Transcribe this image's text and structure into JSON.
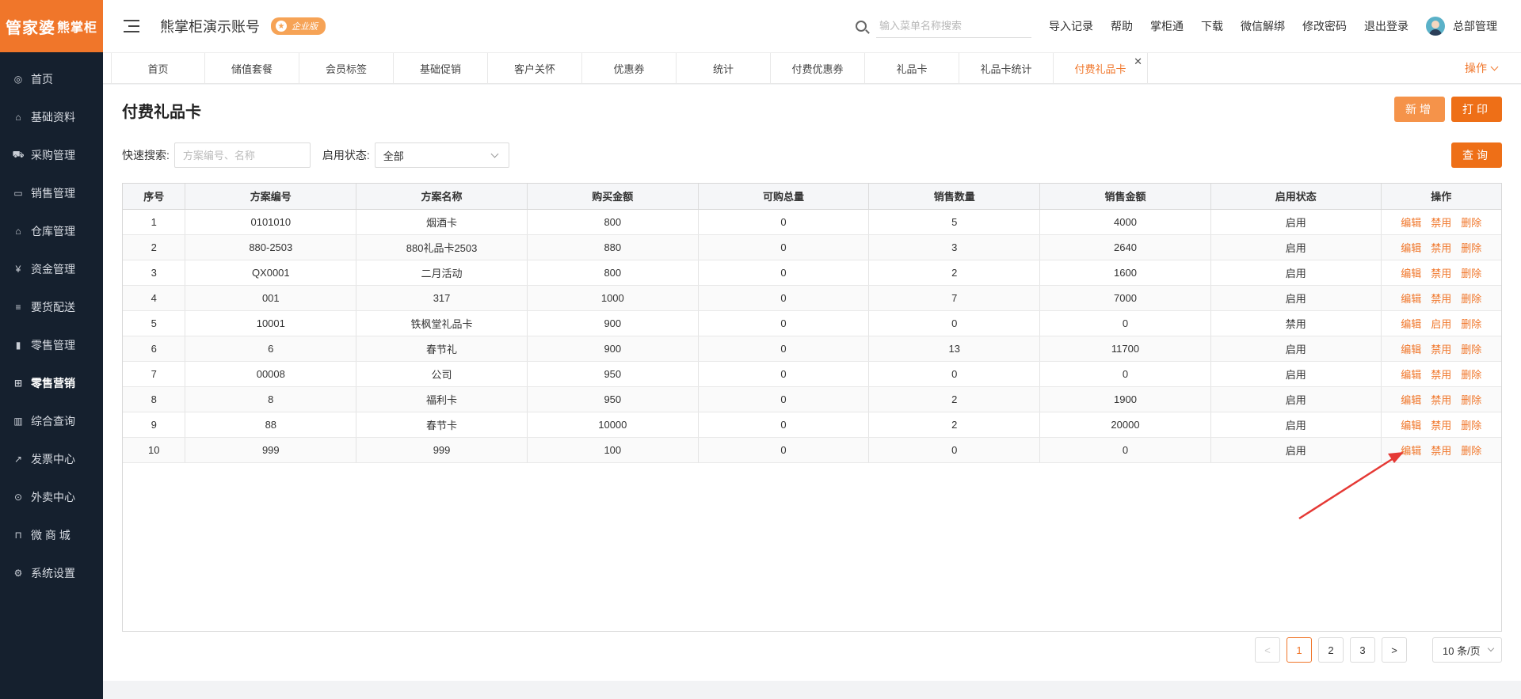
{
  "logo": {
    "text": "管家婆",
    "sub": "熊掌柜"
  },
  "sidebar": {
    "items": [
      {
        "label": "首页",
        "icon": "globe-icon"
      },
      {
        "label": "基础资料",
        "icon": "home-icon"
      },
      {
        "label": "采购管理",
        "icon": "cart-icon"
      },
      {
        "label": "销售管理",
        "icon": "card-icon"
      },
      {
        "label": "仓库管理",
        "icon": "bank-icon"
      },
      {
        "label": "资金管理",
        "icon": "money-icon"
      },
      {
        "label": "要货配送",
        "icon": "list-icon"
      },
      {
        "label": "零售管理",
        "icon": "bar-chart-icon"
      },
      {
        "label": "零售营销",
        "icon": "gift-icon",
        "active": true
      },
      {
        "label": "综合查询",
        "icon": "chart-icon"
      },
      {
        "label": "发票中心",
        "icon": "trend-icon"
      },
      {
        "label": "外卖中心",
        "icon": "delivery-icon"
      },
      {
        "label": "微 商 城",
        "icon": "shop-icon"
      },
      {
        "label": "系统设置",
        "icon": "gear-icon"
      }
    ]
  },
  "header": {
    "account": "熊掌柜演示账号",
    "badge": "企业版",
    "search_placeholder": "输入菜单名称搜索",
    "links": [
      "导入记录",
      "帮助",
      "掌柜通",
      "下载",
      "微信解绑",
      "修改密码",
      "退出登录"
    ],
    "user": "总部管理"
  },
  "tabs": {
    "items": [
      "首页",
      "储值套餐",
      "会员标签",
      "基础促销",
      "客户关怀",
      "优惠券",
      "统计",
      "付费优惠券",
      "礼品卡",
      "礼品卡统计",
      "付费礼品卡"
    ],
    "active_index": 10,
    "ops_label": "操作"
  },
  "page": {
    "title": "付费礼品卡",
    "add_label": "新增",
    "print_label": "打印",
    "query_label": "查询"
  },
  "filter": {
    "search_label": "快速搜索:",
    "search_placeholder": "方案编号、名称",
    "status_label": "启用状态:",
    "status_value": "全部"
  },
  "table": {
    "columns": [
      "序号",
      "方案编号",
      "方案名称",
      "购买金额",
      "可购总量",
      "销售数量",
      "销售金额",
      "启用状态",
      "操作"
    ],
    "rows": [
      {
        "no": "1",
        "code": "0101010",
        "name": "烟酒卡",
        "amount": "800",
        "total": "0",
        "qty": "5",
        "sales": "4000",
        "status": "启用",
        "ops": [
          "编辑",
          "禁用",
          "删除"
        ]
      },
      {
        "no": "2",
        "code": "880-2503",
        "name": "880礼品卡2503",
        "amount": "880",
        "total": "0",
        "qty": "3",
        "sales": "2640",
        "status": "启用",
        "ops": [
          "编辑",
          "禁用",
          "删除"
        ]
      },
      {
        "no": "3",
        "code": "QX0001",
        "name": "二月活动",
        "amount": "800",
        "total": "0",
        "qty": "2",
        "sales": "1600",
        "status": "启用",
        "ops": [
          "编辑",
          "禁用",
          "删除"
        ]
      },
      {
        "no": "4",
        "code": "001",
        "name": "317",
        "amount": "1000",
        "total": "0",
        "qty": "7",
        "sales": "7000",
        "status": "启用",
        "ops": [
          "编辑",
          "禁用",
          "删除"
        ]
      },
      {
        "no": "5",
        "code": "10001",
        "name": "铁枫堂礼品卡",
        "amount": "900",
        "total": "0",
        "qty": "0",
        "sales": "0",
        "status": "禁用",
        "ops": [
          "编辑",
          "启用",
          "删除"
        ]
      },
      {
        "no": "6",
        "code": "6",
        "name": "春节礼",
        "amount": "900",
        "total": "0",
        "qty": "13",
        "sales": "11700",
        "status": "启用",
        "ops": [
          "编辑",
          "禁用",
          "删除"
        ]
      },
      {
        "no": "7",
        "code": "00008",
        "name": "公司",
        "amount": "950",
        "total": "0",
        "qty": "0",
        "sales": "0",
        "status": "启用",
        "ops": [
          "编辑",
          "禁用",
          "删除"
        ]
      },
      {
        "no": "8",
        "code": "8",
        "name": "福利卡",
        "amount": "950",
        "total": "0",
        "qty": "2",
        "sales": "1900",
        "status": "启用",
        "ops": [
          "编辑",
          "禁用",
          "删除"
        ]
      },
      {
        "no": "9",
        "code": "88",
        "name": "春节卡",
        "amount": "10000",
        "total": "0",
        "qty": "2",
        "sales": "20000",
        "status": "启用",
        "ops": [
          "编辑",
          "禁用",
          "删除"
        ]
      },
      {
        "no": "10",
        "code": "999",
        "name": "999",
        "amount": "100",
        "total": "0",
        "qty": "0",
        "sales": "0",
        "status": "启用",
        "ops": [
          "编辑",
          "禁用",
          "删除"
        ]
      }
    ]
  },
  "pager": {
    "prev": "<",
    "next": ">",
    "pages": [
      "1",
      "2",
      "3"
    ],
    "current": "1",
    "page_size": "10 条/页"
  },
  "colors": {
    "accent": "#f0762a",
    "sidebar": "#15202e",
    "annotation": "#e53935"
  }
}
